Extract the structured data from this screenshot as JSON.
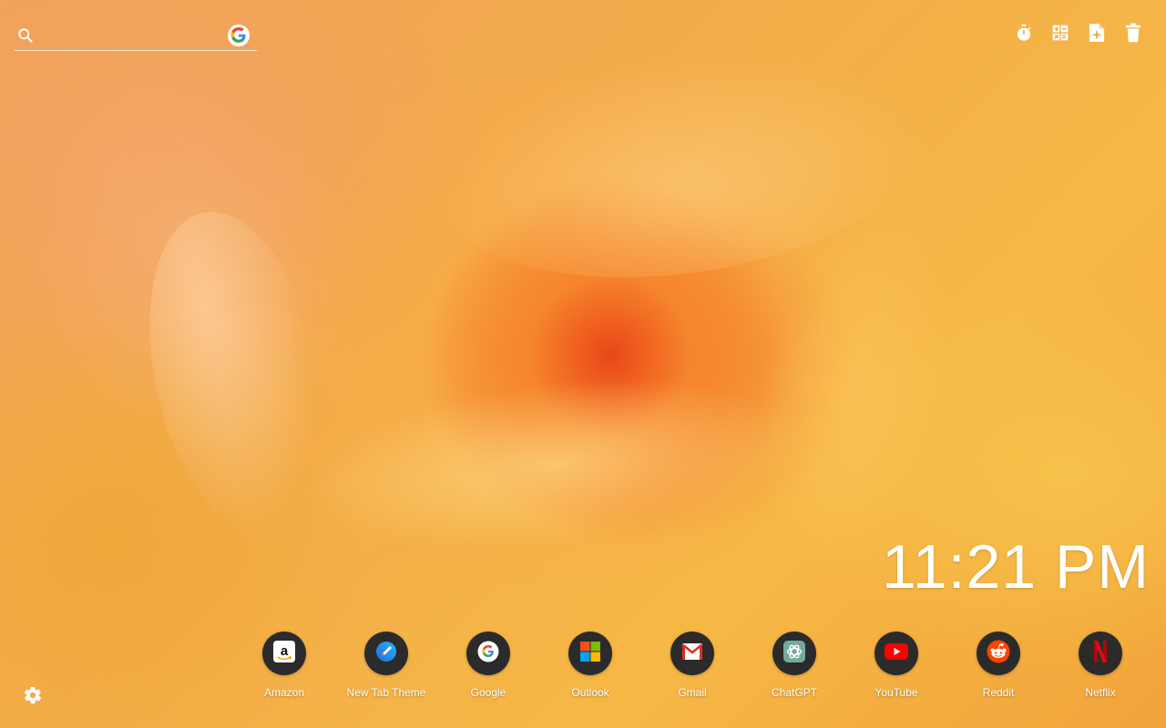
{
  "search": {
    "placeholder": "",
    "engine_icon": "google-icon"
  },
  "toolbar": {
    "icons": [
      "timer-icon",
      "calculator-icon",
      "add-note-icon",
      "trash-icon"
    ]
  },
  "clock": {
    "time": "11:21 PM"
  },
  "shortcuts": [
    {
      "label": "Amazon",
      "icon": "amazon-icon"
    },
    {
      "label": "New Tab Theme",
      "icon": "new-tab-theme-icon"
    },
    {
      "label": "Google",
      "icon": "google-icon"
    },
    {
      "label": "Outlook",
      "icon": "microsoft-icon"
    },
    {
      "label": "Gmail",
      "icon": "gmail-icon"
    },
    {
      "label": "ChatGPT",
      "icon": "chatgpt-icon"
    },
    {
      "label": "YouTube",
      "icon": "youtube-icon"
    },
    {
      "label": "Reddit",
      "icon": "reddit-icon"
    },
    {
      "label": "Netflix",
      "icon": "netflix-icon"
    }
  ],
  "settings": {
    "icon": "gear-icon"
  },
  "colors": {
    "shortcut_bg": "#2b2b2b",
    "background_accent": "#f5a43c"
  }
}
